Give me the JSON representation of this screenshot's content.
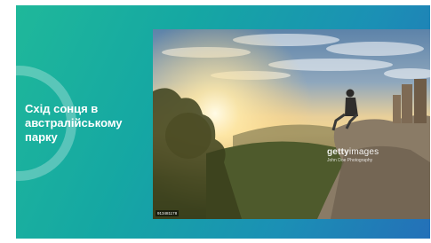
{
  "slide": {
    "title": "Схід сонця в австралійському парку",
    "accent_colors": [
      "#1fb89a",
      "#2470b8"
    ]
  },
  "photo": {
    "watermark_brand_bold": "getty",
    "watermark_brand_light": "images",
    "watermark_credit": "John Doe Photography",
    "photo_id": "913481178"
  }
}
